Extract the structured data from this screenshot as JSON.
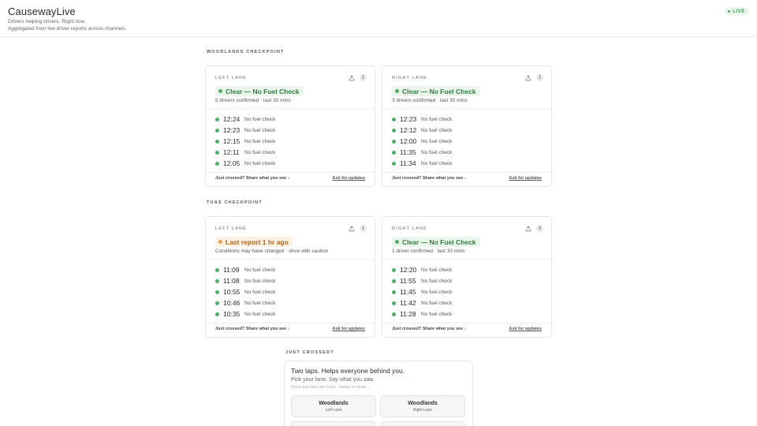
{
  "header": {
    "brand": "CausewayLive",
    "tagline_1": "Drivers helping drivers. Right now.",
    "tagline_2": "Aggregated from live driver reports across channels.",
    "live_badge": "LIVE",
    "live_color": "#4caf63"
  },
  "colors": {
    "clear": "#4caf63",
    "warn": "#f0a04b"
  },
  "checkpoints": [
    {
      "label": "WOODLANDS CHECKPOINT",
      "lanes": [
        {
          "lane": "LEFT LANE",
          "status": "Clear — No Fuel Check",
          "status_type": "clear",
          "summary": "5 drivers confirmed · last 30 mins",
          "reports": [
            {
              "time": "12:24",
              "note": "No fuel check"
            },
            {
              "time": "12:23",
              "note": "No fuel check"
            },
            {
              "time": "12:15",
              "note": "No fuel check"
            },
            {
              "time": "12:11",
              "note": "No fuel check"
            },
            {
              "time": "12:05",
              "note": "No fuel check"
            }
          ],
          "footer_left": "Just crossed? Share what you see ↓",
          "footer_right": "Ask for updates"
        },
        {
          "lane": "RIGHT LANE",
          "status": "Clear — No Fuel Check",
          "status_type": "clear",
          "summary": "3 drivers confirmed · last 30 mins",
          "reports": [
            {
              "time": "12:23",
              "note": "No fuel check"
            },
            {
              "time": "12:12",
              "note": "No fuel check"
            },
            {
              "time": "12:00",
              "note": "No fuel check"
            },
            {
              "time": "11:35",
              "note": "No fuel check"
            },
            {
              "time": "11:34",
              "note": "No fuel check"
            }
          ],
          "footer_left": "Just crossed? Share what you see ↓",
          "footer_right": "Ask for updates"
        }
      ]
    },
    {
      "label": "TUAS CHECKPOINT",
      "lanes": [
        {
          "lane": "LEFT LANE",
          "status": "Last report 1 hr ago",
          "status_type": "warn",
          "summary": "Conditions may have changed · drive with caution",
          "reports": [
            {
              "time": "11:09",
              "note": "No fuel check"
            },
            {
              "time": "11:08",
              "note": "No fuel check"
            },
            {
              "time": "10:55",
              "note": "No fuel check"
            },
            {
              "time": "10:46",
              "note": "No fuel check"
            },
            {
              "time": "10:35",
              "note": "No fuel check"
            }
          ],
          "footer_left": "Just crossed? Share what you see ↓",
          "footer_right": "Ask for updates"
        },
        {
          "lane": "RIGHT LANE",
          "status": "Clear — No Fuel Check",
          "status_type": "clear",
          "summary": "1 driver confirmed · last 30 mins",
          "reports": [
            {
              "time": "12:20",
              "note": "No fuel check"
            },
            {
              "time": "11:55",
              "note": "No fuel check"
            },
            {
              "time": "11:45",
              "note": "No fuel check"
            },
            {
              "time": "11:42",
              "note": "No fuel check"
            },
            {
              "time": "11:28",
              "note": "No fuel check"
            }
          ],
          "footer_left": "Just crossed? Share what you see ↓",
          "footer_right": "Ask for updates"
        }
      ]
    }
  ],
  "share": {
    "label": "JUST CROSSED?",
    "title": "Two taps. Helps everyone behind you.",
    "subtitle": "Pick your lane. Say what you saw.",
    "hint": "Once per lane per hour · keeps it clean...",
    "options": [
      {
        "place": "Woodlands",
        "lane": "Left Lane"
      },
      {
        "place": "Woodlands",
        "lane": "Right Lane"
      }
    ]
  }
}
